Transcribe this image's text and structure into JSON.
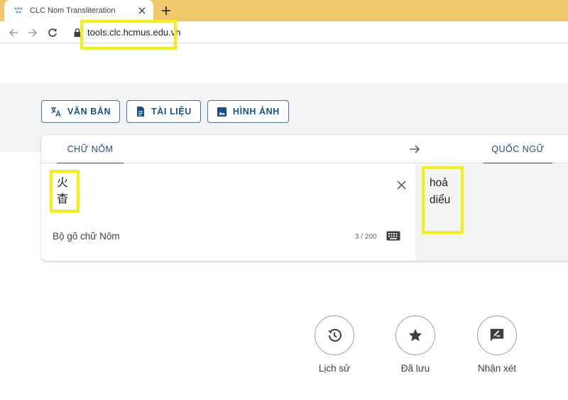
{
  "browser": {
    "tab_title": "CLC Nom Transliteration",
    "url": "tools.clc.hcmus.edu.vn",
    "tab_close_icon": "close-icon",
    "new_tab_icon": "plus-icon"
  },
  "modes": [
    {
      "label": "VĂN BẢN",
      "icon": "translate-icon"
    },
    {
      "label": "TÀI LIỆU",
      "icon": "document-icon"
    },
    {
      "label": "HÌNH ẢNH",
      "icon": "image-icon"
    }
  ],
  "translator": {
    "source_lang": "CHỮ NÔM",
    "target_lang": "QUỐC NGỮ",
    "source_lines": [
      "火",
      "杳"
    ],
    "target_lines": [
      "hoả",
      "diểu"
    ],
    "ime_label": "Bộ gõ chữ Nôm",
    "char_count": "3 / 200"
  },
  "actions": [
    {
      "label": "Lịch sử",
      "icon": "history-icon"
    },
    {
      "label": "Đã lưu",
      "icon": "star-icon"
    },
    {
      "label": "Nhận xét",
      "icon": "feedback-icon"
    }
  ],
  "colors": {
    "accent": "#1a4f86",
    "highlight": "#f5ef0f",
    "tabstrip": "#f0c76b"
  }
}
